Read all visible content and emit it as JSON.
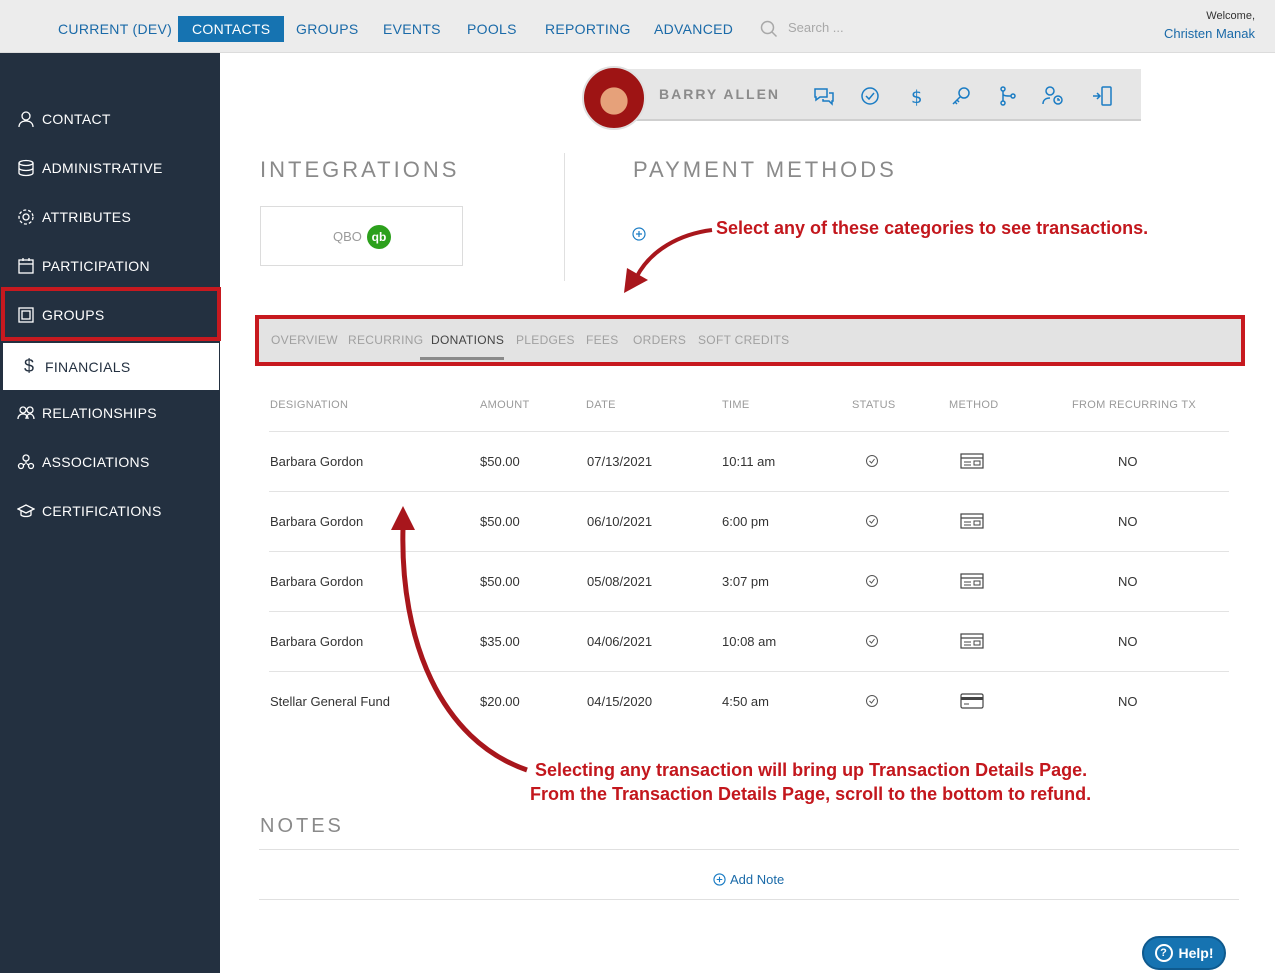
{
  "nav": {
    "items": [
      "CURRENT (DEV)",
      "CONTACTS",
      "GROUPS",
      "EVENTS",
      "POOLS",
      "REPORTING",
      "ADVANCED"
    ],
    "active": "CONTACTS",
    "search_placeholder": "Search ...",
    "welcome_label": "Welcome,",
    "user_name": "Christen Manak"
  },
  "sidebar": {
    "items": [
      {
        "label": "CONTACT",
        "icon": "person-icon"
      },
      {
        "label": "ADMINISTRATIVE",
        "icon": "database-icon"
      },
      {
        "label": "ATTRIBUTES",
        "icon": "gear-icon"
      },
      {
        "label": "PARTICIPATION",
        "icon": "calendar-icon"
      },
      {
        "label": "GROUPS",
        "icon": "group-frame-icon"
      },
      {
        "label": "FINANCIALS",
        "icon": "dollar-icon"
      },
      {
        "label": "RELATIONSHIPS",
        "icon": "people-icon"
      },
      {
        "label": "ASSOCIATIONS",
        "icon": "org-icon"
      },
      {
        "label": "CERTIFICATIONS",
        "icon": "graduation-cap-icon"
      }
    ],
    "active": "FINANCIALS"
  },
  "profile": {
    "name": "BARRY ALLEN",
    "actions": [
      "chat-icon",
      "check-circle-icon",
      "dollar-icon",
      "key-icon",
      "branch-icon",
      "user-clock-icon",
      "mobile-login-icon"
    ]
  },
  "integrations": {
    "title": "INTEGRATIONS",
    "qbo_label": "QBO",
    "qb_logo": "qb"
  },
  "payment_methods": {
    "title": "PAYMENT METHODS"
  },
  "annotations": {
    "top": "Select any of these categories to see transactions.",
    "bottom_line1": "Selecting any transaction will bring up Transaction Details Page.",
    "bottom_line2": "From the Transaction Details Page, scroll to the bottom to refund."
  },
  "tabs": {
    "items": [
      "OVERVIEW",
      "RECURRING",
      "DONATIONS",
      "PLEDGES",
      "FEES",
      "ORDERS",
      "SOFT CREDITS"
    ],
    "active": "DONATIONS"
  },
  "table": {
    "headers": [
      "DESIGNATION",
      "AMOUNT",
      "DATE",
      "TIME",
      "STATUS",
      "METHOD",
      "FROM RECURRING TX"
    ],
    "rows": [
      {
        "designation": "Barbara Gordon",
        "amount": "$50.00",
        "date": "07/13/2021",
        "time": "10:11 am",
        "status": "check-circle-icon",
        "method": "check-payment-icon",
        "recurring": "NO"
      },
      {
        "designation": "Barbara Gordon",
        "amount": "$50.00",
        "date": "06/10/2021",
        "time": "6:00 pm",
        "status": "check-circle-icon",
        "method": "check-payment-icon",
        "recurring": "NO"
      },
      {
        "designation": "Barbara Gordon",
        "amount": "$50.00",
        "date": "05/08/2021",
        "time": "3:07 pm",
        "status": "check-circle-icon",
        "method": "check-payment-icon",
        "recurring": "NO"
      },
      {
        "designation": "Barbara Gordon",
        "amount": "$35.00",
        "date": "04/06/2021",
        "time": "10:08 am",
        "status": "check-circle-icon",
        "method": "check-payment-icon",
        "recurring": "NO"
      },
      {
        "designation": "Stellar General Fund",
        "amount": "$20.00",
        "date": "04/15/2020",
        "time": "4:50 am",
        "status": "check-circle-icon",
        "method": "credit-card-icon",
        "recurring": "NO"
      }
    ]
  },
  "notes": {
    "title": "NOTES",
    "add_label": "Add Note"
  },
  "help": {
    "label": "Help!"
  },
  "colors": {
    "accent": "#1673b1",
    "sidebar": "#233040",
    "annotation": "#c3171d"
  }
}
